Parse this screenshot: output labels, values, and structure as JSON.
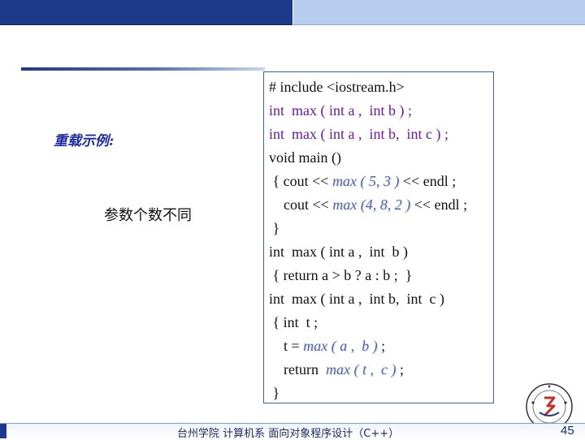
{
  "colors": {
    "header_dark": "#1d3a8a",
    "header_light": "#b7cdf0",
    "title_blue": "#1f2ba5",
    "code_purple": "#6a1aa0",
    "code_italic": "#5566a8",
    "box_border": "#3a5fb3"
  },
  "slide": {
    "title": "重载示例:",
    "subtitle": "参数个数不同"
  },
  "code": {
    "l1": "# include <iostream.h>",
    "l2": "int  max ( int a ,  int b ) ;",
    "l3": "int  max ( int a ,  int b,  int c ) ;",
    "l4": "void main ()",
    "l5_a": " { cout << ",
    "l5_b": "max ( 5, 3 )",
    "l5_c": " << endl ;",
    "l6_a": "    cout << ",
    "l6_b": "max (4, 8, 2 )",
    "l6_c": " << endl ;",
    "l7": " }",
    "l8": "int  max ( int a ,  int  b )",
    "l9": " { return a > b ? a : b ;  }",
    "l10": "int  max ( int a ,  int b,  int  c )",
    "l11": " { int  t ;",
    "l12_a": "    t = ",
    "l12_b": "max ( a ,  b )",
    "l12_c": " ;",
    "l13_a": "    return  ",
    "l13_b": "max ( t ,  c )",
    "l13_c": " ;",
    "l14": " }"
  },
  "footer": {
    "text": "台州学院 计算机系 面向对象程序设计（C++）",
    "page": "45"
  },
  "logo": {
    "icon": "university-seal-icon"
  }
}
